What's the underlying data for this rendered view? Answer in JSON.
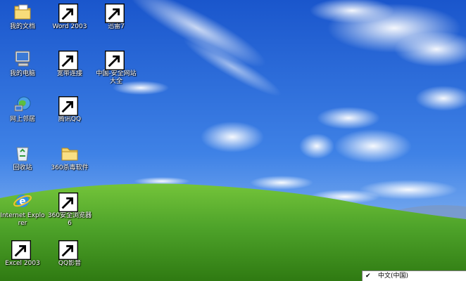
{
  "desktop": {
    "icons": [
      {
        "label": "我的文档",
        "icon": "my-documents-icon",
        "shortcut": false
      },
      {
        "label": "Word 2003",
        "icon": "word-icon",
        "shortcut": true
      },
      {
        "label": "迅雷7",
        "icon": "thunder-icon",
        "shortcut": true
      },
      {
        "label": "我的电脑",
        "icon": "my-computer-icon",
        "shortcut": false
      },
      {
        "label": "宽带连接",
        "icon": "broadband-icon",
        "shortcut": true
      },
      {
        "label": "中国-安全网站大全",
        "icon": "ie-green-icon",
        "shortcut": true
      },
      {
        "label": "网上邻居",
        "icon": "network-icon",
        "shortcut": false
      },
      {
        "label": "腾讯QQ",
        "icon": "qq-icon",
        "shortcut": true
      },
      {
        "label": "回收站",
        "icon": "recycle-bin-icon",
        "shortcut": false
      },
      {
        "label": "360杀毒软件",
        "icon": "folder-icon",
        "shortcut": false
      },
      {
        "label": "Internet Explorer",
        "icon": "ie-icon",
        "shortcut": false
      },
      {
        "label": "360安全浏览器6",
        "icon": "browser-360-icon",
        "shortcut": true
      },
      {
        "label": "Excel 2003",
        "icon": "excel-icon",
        "shortcut": true
      },
      {
        "label": "QQ影音",
        "icon": "qq-player-icon",
        "shortcut": true
      }
    ]
  },
  "language_menu": {
    "selected": "中文(中国)",
    "check": "✔"
  },
  "colors": {
    "sky_top": "#1d5fd4",
    "sky_bottom": "#8fbcf5",
    "grass": "#4ea32a",
    "grass_dark": "#2f7a12"
  }
}
